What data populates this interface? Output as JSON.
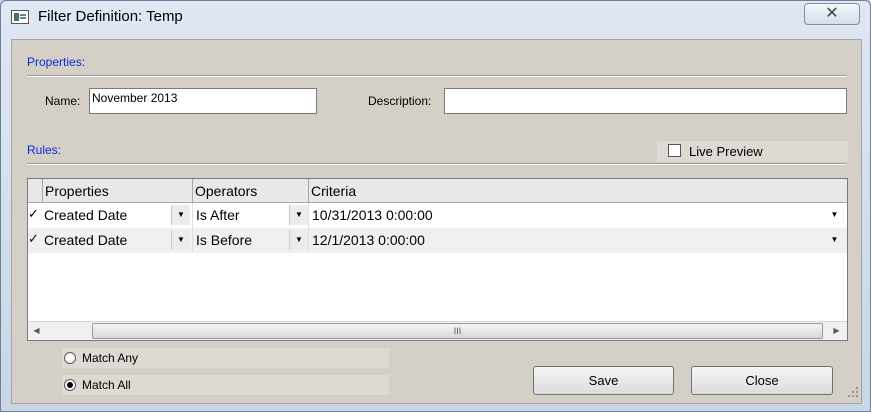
{
  "window": {
    "title": "Filter Definition: Temp",
    "close_glyph": "✕",
    "app_icon": "filter-definition-icon"
  },
  "properties": {
    "section_label": "Properties:",
    "name_label": "Name:",
    "name_value": "November 2013",
    "description_label": "Description:",
    "description_value": ""
  },
  "rules": {
    "section_label": "Rules:",
    "live_preview_label": "Live Preview",
    "live_preview_checked": false,
    "columns": [
      "Properties",
      "Operators",
      "Criteria"
    ],
    "rows": [
      {
        "checked": true,
        "check_glyph": "✓",
        "property": "Created Date",
        "operator": "Is After",
        "criteria": "10/31/2013 0:00:00"
      },
      {
        "checked": true,
        "check_glyph": "✓",
        "property": "Created Date",
        "operator": "Is Before",
        "criteria": "12/1/2013 0:00:00"
      }
    ]
  },
  "scrollbar": {
    "left_arrow": "◀",
    "right_arrow": "▶",
    "thumb_grip": "III"
  },
  "dropdown_arrow": "▼",
  "match": {
    "options": [
      {
        "label": "Match Any",
        "selected": false
      },
      {
        "label": "Match All",
        "selected": true
      }
    ]
  },
  "buttons": {
    "save": "Save",
    "close": "Close"
  },
  "colors": {
    "section_label": "#0a2bd1",
    "dialog_background": "#d4d0c8"
  }
}
